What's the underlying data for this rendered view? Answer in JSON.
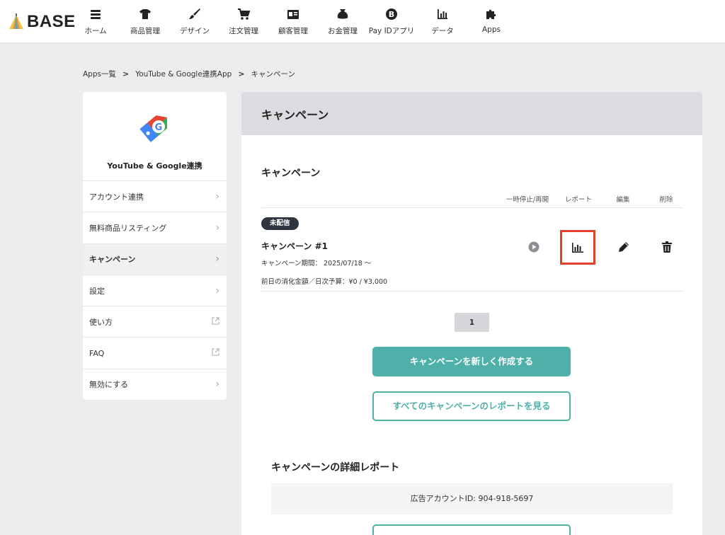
{
  "brand": {
    "name": "BASE"
  },
  "nav": [
    {
      "label": "ホーム",
      "icon": "home-list-icon"
    },
    {
      "label": "商品管理",
      "icon": "tshirt-icon"
    },
    {
      "label": "デザイン",
      "icon": "brush-icon"
    },
    {
      "label": "注文管理",
      "icon": "cart-icon"
    },
    {
      "label": "顧客管理",
      "icon": "id-card-icon"
    },
    {
      "label": "お金管理",
      "icon": "wallet-icon"
    },
    {
      "label": "Pay IDアプリ",
      "icon": "pay-id-icon"
    },
    {
      "label": "データ",
      "icon": "bar-chart-icon"
    },
    {
      "label": "Apps",
      "icon": "puzzle-icon"
    }
  ],
  "breadcrumb": [
    "Apps一覧",
    "YouTube & Google連携App",
    "キャンペーン"
  ],
  "sidebar": {
    "app_name": "YouTube & Google連携",
    "items": [
      {
        "label": "アカウント連携",
        "type": "arrow"
      },
      {
        "label": "無料商品リスティング",
        "type": "arrow"
      },
      {
        "label": "キャンペーン",
        "type": "arrow",
        "active": true
      },
      {
        "label": "設定",
        "type": "arrow"
      },
      {
        "label": "使い方",
        "type": "external"
      },
      {
        "label": "FAQ",
        "type": "external"
      },
      {
        "label": "無効にする",
        "type": "arrow"
      }
    ]
  },
  "main": {
    "header_title": "キャンペーン",
    "section_title": "キャンペーン",
    "columns": {
      "pause": "一時停止/再開",
      "report": "レポート",
      "edit": "編集",
      "delete": "削除"
    },
    "campaign": {
      "badge": "未配信",
      "name": "キャンペーン #1",
      "period": "キャンペーン期間： 2025/07/18 〜",
      "budget": "前日の消化金額／日次予算：¥0 / ¥3,000"
    },
    "pagination": {
      "current": "1"
    },
    "create_button": "キャンペーンを新しく作成する",
    "all_reports_button": "すべてのキャンペーンのレポートを見る",
    "detail_title": "キャンペーンの詳細レポート",
    "account_id": "広告アカウントID: 904-918-5697"
  },
  "colors": {
    "accent": "#4eb0a8",
    "highlight": "#e2402b",
    "badge": "#2f3540"
  }
}
